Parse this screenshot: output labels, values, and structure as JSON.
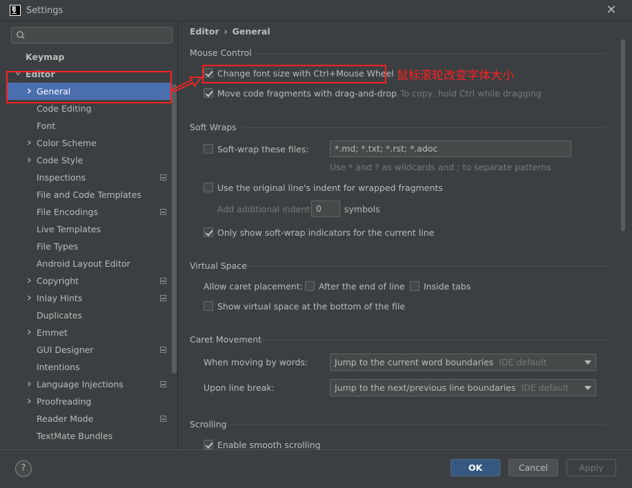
{
  "window": {
    "title": "Settings",
    "icon_text": "IJ",
    "close_icon": "close-icon"
  },
  "sidebar": {
    "search_placeholder": "",
    "items": [
      {
        "label": "Keymap",
        "level": 0,
        "bold": true,
        "arrow": "none"
      },
      {
        "label": "Editor",
        "level": 0,
        "bold": true,
        "arrow": "down"
      },
      {
        "label": "General",
        "level": 1,
        "arrow": "right",
        "selected": true
      },
      {
        "label": "Code Editing",
        "level": 1,
        "arrow": "none"
      },
      {
        "label": "Font",
        "level": 1,
        "arrow": "none"
      },
      {
        "label": "Color Scheme",
        "level": 1,
        "arrow": "right"
      },
      {
        "label": "Code Style",
        "level": 1,
        "arrow": "right"
      },
      {
        "label": "Inspections",
        "level": 1,
        "arrow": "none",
        "project": true
      },
      {
        "label": "File and Code Templates",
        "level": 1,
        "arrow": "none"
      },
      {
        "label": "File Encodings",
        "level": 1,
        "arrow": "none",
        "project": true
      },
      {
        "label": "Live Templates",
        "level": 1,
        "arrow": "none"
      },
      {
        "label": "File Types",
        "level": 1,
        "arrow": "none"
      },
      {
        "label": "Android Layout Editor",
        "level": 1,
        "arrow": "none"
      },
      {
        "label": "Copyright",
        "level": 1,
        "arrow": "right",
        "project": true
      },
      {
        "label": "Inlay Hints",
        "level": 1,
        "arrow": "right",
        "project": true
      },
      {
        "label": "Duplicates",
        "level": 1,
        "arrow": "none"
      },
      {
        "label": "Emmet",
        "level": 1,
        "arrow": "right"
      },
      {
        "label": "GUI Designer",
        "level": 1,
        "arrow": "none",
        "project": true
      },
      {
        "label": "Intentions",
        "level": 1,
        "arrow": "none"
      },
      {
        "label": "Language Injections",
        "level": 1,
        "arrow": "right",
        "project": true
      },
      {
        "label": "Proofreading",
        "level": 1,
        "arrow": "right"
      },
      {
        "label": "Reader Mode",
        "level": 1,
        "arrow": "none",
        "project": true
      },
      {
        "label": "TextMate Bundles",
        "level": 1,
        "arrow": "none"
      }
    ]
  },
  "breadcrumb": {
    "parent": "Editor",
    "separator": "›",
    "current": "General"
  },
  "mouse_control": {
    "title": "Mouse Control",
    "change_font_label": "Change font size with Ctrl+Mouse Wheel",
    "change_font_checked": true,
    "move_fragments_label": "Move code fragments with drag-and-drop",
    "move_fragments_checked": true,
    "move_fragments_hint": "To copy, hold Ctrl while dragging"
  },
  "soft_wraps": {
    "title": "Soft Wraps",
    "softwrap_label": "Soft-wrap these files:",
    "softwrap_checked": false,
    "softwrap_value": "*.md; *.txt; *.rst; *.adoc",
    "softwrap_hint": "Use * and ? as wildcards and ; to separate patterns",
    "original_indent_label": "Use the original line's indent for wrapped fragments",
    "original_indent_checked": false,
    "additional_indent_label": "Add additional indent:",
    "additional_indent_value": "0",
    "symbols_label": "symbols",
    "indicators_label": "Only show soft-wrap indicators for the current line",
    "indicators_checked": true
  },
  "virtual_space": {
    "title": "Virtual Space",
    "caret_placement_label": "Allow caret placement:",
    "after_end_label": "After the end of line",
    "after_end_checked": false,
    "inside_tabs_label": "Inside tabs",
    "inside_tabs_checked": false,
    "show_bottom_label": "Show virtual space at the bottom of the file",
    "show_bottom_checked": false
  },
  "caret_movement": {
    "title": "Caret Movement",
    "words_label": "When moving by words:",
    "words_value": "Jump to the current word boundaries",
    "words_default": "IDE default",
    "line_break_label": "Upon line break:",
    "line_break_value": "Jump to the next/previous line boundaries",
    "line_break_default": "IDE default"
  },
  "scrolling": {
    "title": "Scrolling",
    "smooth_label": "Enable smooth scrolling",
    "smooth_checked": true
  },
  "annotation": {
    "text": "鼠标滚轮改变字体大小",
    "color": "#ff2020"
  },
  "footer": {
    "help_label": "?",
    "ok_label": "OK",
    "cancel_label": "Cancel",
    "apply_label": "Apply"
  },
  "colors": {
    "background": "#3c3f41",
    "selection": "#4b6eaf",
    "ok_button": "#365880",
    "annotation_red": "#ff2020"
  }
}
